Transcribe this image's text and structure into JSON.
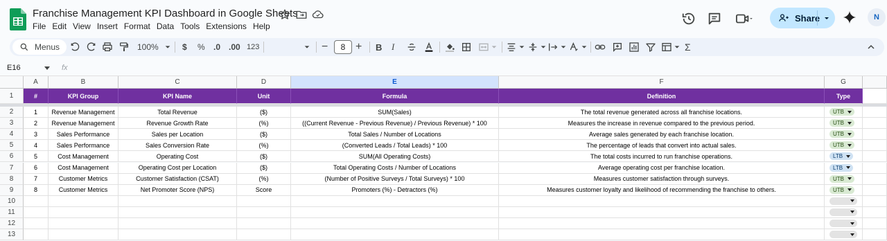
{
  "app": {
    "title": "Franchise Management KPI Dashboard in Google Sheets",
    "menu": [
      "File",
      "Edit",
      "View",
      "Insert",
      "Format",
      "Data",
      "Tools",
      "Extensions",
      "Help"
    ],
    "share_label": "Share",
    "avatar_initial": "N"
  },
  "toolbar": {
    "menus_label": "Menus",
    "zoom": "100%",
    "currency": "$",
    "percent": "%",
    "dec_decrease": ".0",
    "dec_increase": ".00",
    "format_123": "123",
    "font_size": "8"
  },
  "formula_bar": {
    "name_box": "E16",
    "fx": "fx"
  },
  "columns": [
    "A",
    "B",
    "C",
    "D",
    "E",
    "F",
    "G"
  ],
  "selected_column": "E",
  "header_row": {
    "row_num": "1",
    "cells": [
      "#",
      "KPI Group",
      "KPI Name",
      "Unit",
      "Formula",
      "Definition",
      "Type"
    ]
  },
  "rows": [
    {
      "row_num": "2",
      "num": "1",
      "group": "Revenue Management",
      "name": "Total Revenue",
      "unit": "($)",
      "formula": "SUM(Sales)",
      "definition": "The total revenue generated across all franchise locations.",
      "type": "UTB"
    },
    {
      "row_num": "3",
      "num": "2",
      "group": "Revenue Management",
      "name": "Revenue Growth Rate",
      "unit": "(%)",
      "formula": "((Current Revenue - Previous Revenue) / Previous Revenue) * 100",
      "definition": "Measures the increase in revenue compared to the previous period.",
      "type": "UTB"
    },
    {
      "row_num": "4",
      "num": "3",
      "group": "Sales Performance",
      "name": "Sales per Location",
      "unit": "($)",
      "formula": "Total Sales / Number of Locations",
      "definition": "Average sales generated by each franchise location.",
      "type": "UTB"
    },
    {
      "row_num": "5",
      "num": "4",
      "group": "Sales Performance",
      "name": "Sales Conversion Rate",
      "unit": "(%)",
      "formula": "(Converted Leads / Total Leads) * 100",
      "definition": "The percentage of leads that convert into actual sales.",
      "type": "UTB"
    },
    {
      "row_num": "6",
      "num": "5",
      "group": "Cost Management",
      "name": "Operating Cost",
      "unit": "($)",
      "formula": "SUM(All Operating Costs)",
      "definition": "The total costs incurred to run franchise operations.",
      "type": "LTB"
    },
    {
      "row_num": "7",
      "num": "6",
      "group": "Cost Management",
      "name": "Operating Cost per Location",
      "unit": "($)",
      "formula": "Total Operating Costs / Number of Locations",
      "definition": "Average operating cost per franchise location.",
      "type": "LTB"
    },
    {
      "row_num": "8",
      "num": "7",
      "group": "Customer Metrics",
      "name": "Customer Satisfaction (CSAT)",
      "unit": "(%)",
      "formula": "(Number of Positive Surveys / Total Surveys) * 100",
      "definition": "Measures customer satisfaction through surveys.",
      "type": "UTB"
    },
    {
      "row_num": "9",
      "num": "8",
      "group": "Customer Metrics",
      "name": "Net Promoter Score (NPS)",
      "unit": "Score",
      "formula": "Promoters (%) - Detractors (%)",
      "definition": "Measures customer loyalty and likelihood of recommending the franchise to others.",
      "type": "UTB"
    }
  ],
  "empty_rows": [
    "10",
    "11",
    "12",
    "13"
  ]
}
